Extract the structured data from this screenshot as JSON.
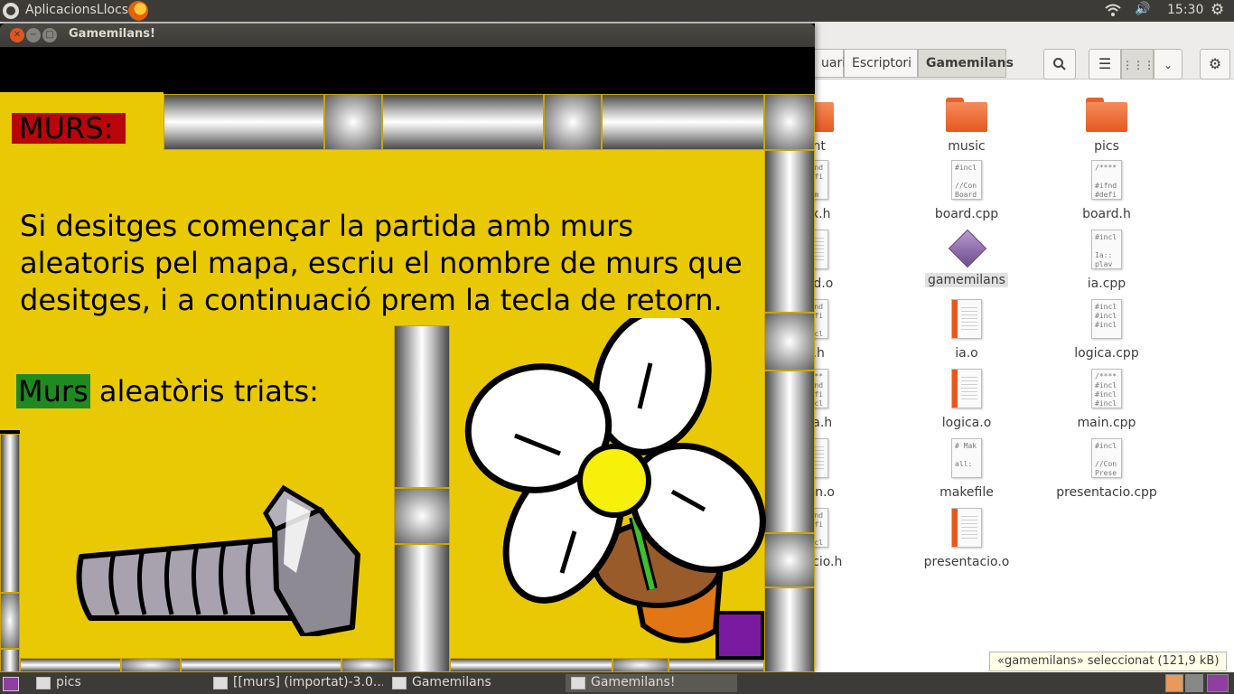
{
  "top_panel": {
    "menu_label": "AplicacionsLlocs",
    "clock": "15:30"
  },
  "game_window": {
    "title": "Gamemilans!",
    "heading": "MURS:",
    "intro_text": "Si desitges començar la partida amb murs aleatoris pel mapa, escriu el nombre de murs que desitges, i a continuació prem la tecla de retorn.",
    "highlight_word": "Murs",
    "triats_text": " aleatòris triats:",
    "colors": {
      "background": "#e9c904",
      "heading_bg": "#b8060a",
      "highlight_bg": "#1f8a1f"
    }
  },
  "file_manager": {
    "breadcrumbs": [
      "uari",
      "Escriptori",
      "Gamemilans"
    ],
    "active_crumb": "Gamemilans",
    "files": [
      {
        "name": "font",
        "kind": "folder"
      },
      {
        "name": "music",
        "kind": "folder"
      },
      {
        "name": "pics",
        "kind": "folder"
      },
      {
        "name": "aux.h",
        "kind": "text",
        "snippet": "#ifnd\n#defi\n\nenum"
      },
      {
        "name": "board.cpp",
        "kind": "text",
        "snippet": "#incl\n\n//Con\nBoard"
      },
      {
        "name": "board.h",
        "kind": "text",
        "snippet": "/****\n\n#ifnd\n#defi"
      },
      {
        "name": "oard.o",
        "kind": "object"
      },
      {
        "name": "gamemilans",
        "kind": "executable",
        "selected": true
      },
      {
        "name": "ia.cpp",
        "kind": "text",
        "snippet": "#incl\n\nIa::\nplav"
      },
      {
        "name": "ia.h",
        "kind": "text",
        "snippet": "#ifnd\n#defi\n\n#incl"
      },
      {
        "name": "ia.o",
        "kind": "object"
      },
      {
        "name": "logica.cpp",
        "kind": "text",
        "snippet": "#incl\n#incl\n#incl"
      },
      {
        "name": "gica.h",
        "kind": "text",
        "snippet": "/****\n#ifnd\n#defi\n#incl"
      },
      {
        "name": "logica.o",
        "kind": "object"
      },
      {
        "name": "main.cpp",
        "kind": "text",
        "snippet": "/****\n#incl\n#incl\n#incl"
      },
      {
        "name": "main.o",
        "kind": "object"
      },
      {
        "name": "makefile",
        "kind": "text",
        "snippet": "# Mak\n\nall:"
      },
      {
        "name": "presentacio.cpp",
        "kind": "text",
        "snippet": "#incl\n\n//Con\nPrese"
      },
      {
        "name": "entacio.h",
        "kind": "text",
        "snippet": "#ifnd\n#defi\n\n#incl"
      },
      {
        "name": "presentacio.o",
        "kind": "object"
      }
    ],
    "status_tooltip": "«gamemilans» seleccionat  (121,9 kB)"
  },
  "taskbar": {
    "items": [
      {
        "label": "pics",
        "active": false
      },
      {
        "label": "[[murs] (importat)-3.0...",
        "active": false
      },
      {
        "label": "Gamemilans",
        "active": false
      },
      {
        "label": "Gamemilans!",
        "active": true
      }
    ]
  }
}
